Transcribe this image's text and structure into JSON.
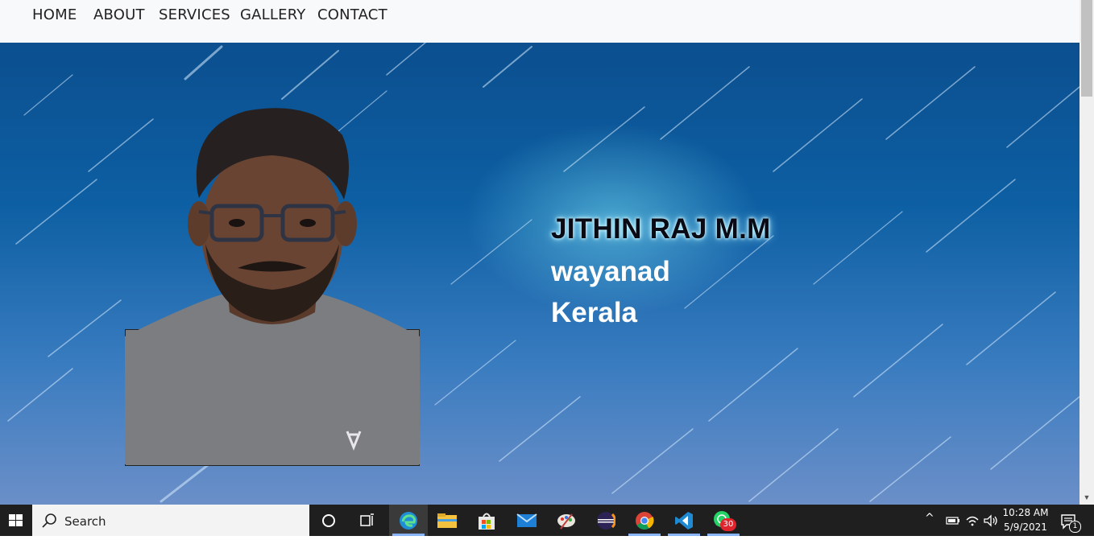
{
  "nav": {
    "items": [
      {
        "label": "HOME"
      },
      {
        "label": "ABOUT"
      },
      {
        "label": "SERVICES"
      },
      {
        "label": "GALLERY"
      },
      {
        "label": "CONTACT"
      }
    ]
  },
  "hero": {
    "name": "JITHIN RAJ M.M",
    "line1": "wayanad",
    "line2": "Kerala"
  },
  "taskbar": {
    "search_label": "Search",
    "whatsapp_badge": "30",
    "clock_time": "10:28 AM",
    "clock_date": "5/9/2021",
    "notification_count": "1"
  },
  "colors": {
    "navbar_bg": "#f8f9fa",
    "hero_blue": "#0d5fa3",
    "taskbar_bg": "#1f1f1f"
  }
}
